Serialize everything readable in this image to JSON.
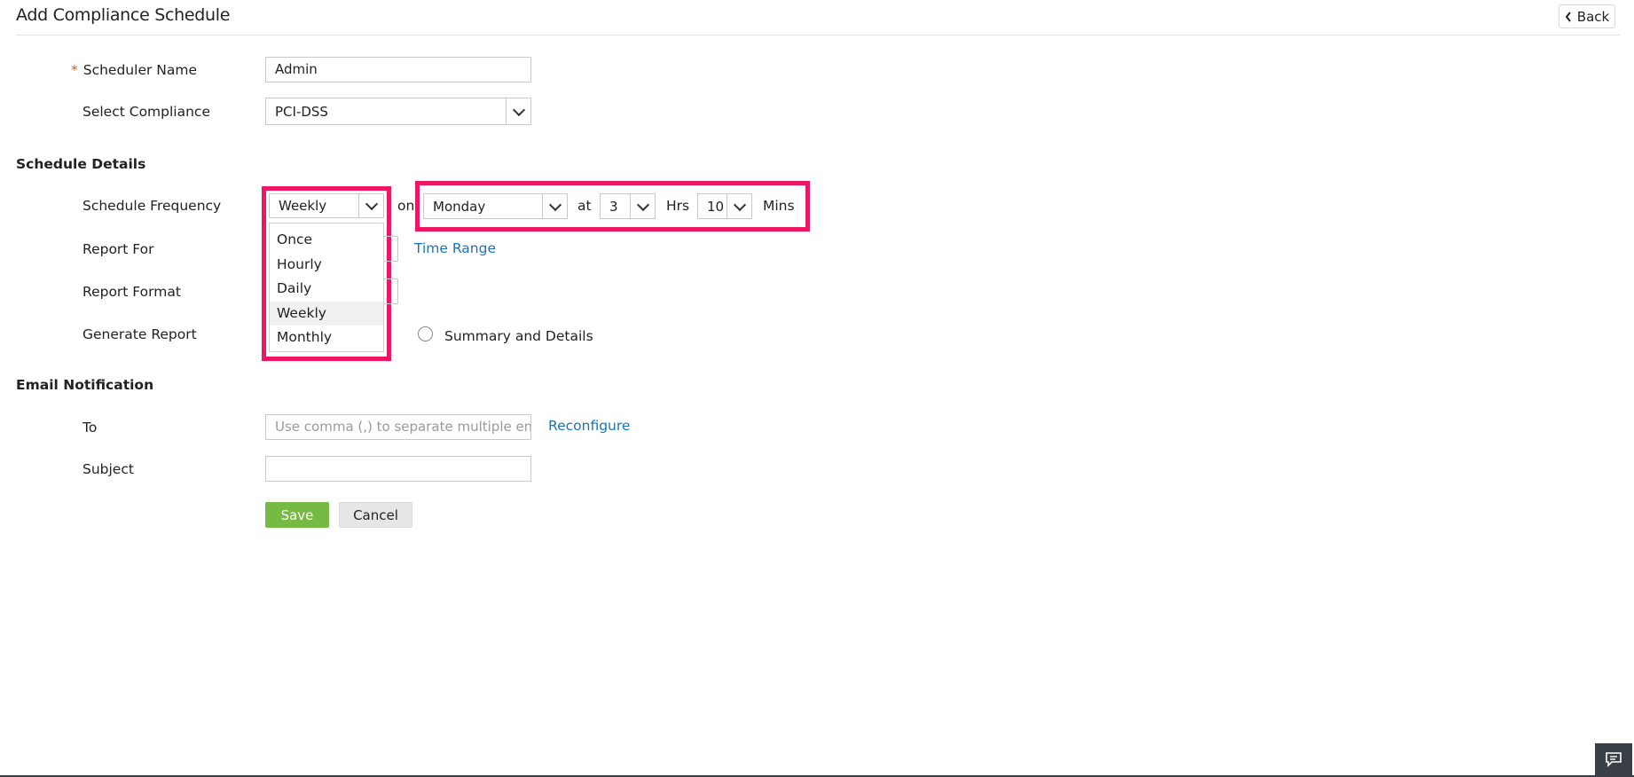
{
  "header": {
    "title": "Add Compliance Schedule",
    "back_label": "Back"
  },
  "form": {
    "scheduler_name": {
      "required_mark": "*",
      "label": "Scheduler Name",
      "value": "Admin"
    },
    "select_compliance": {
      "label": "Select Compliance",
      "value": "PCI-DSS"
    }
  },
  "schedule_details": {
    "heading": "Schedule Details",
    "frequency": {
      "label": "Schedule Frequency",
      "value": "Weekly",
      "options": [
        "Once",
        "Hourly",
        "Daily",
        "Weekly",
        "Monthly"
      ],
      "on_label": "on",
      "day_value": "Monday",
      "at_label": "at",
      "hour_value": "3",
      "hrs_label": "Hrs",
      "min_value": "10",
      "mins_label": "Mins"
    },
    "report_for": {
      "label": "Report For",
      "time_range_link": "Time Range"
    },
    "report_format": {
      "label": "Report Format"
    },
    "generate_report": {
      "label": "Generate Report",
      "option_summary_details": "Summary and Details"
    }
  },
  "email_notification": {
    "heading": "Email Notification",
    "to": {
      "label": "To",
      "placeholder": "Use comma (,) to separate multiple ema",
      "reconfigure_link": "Reconfigure"
    },
    "subject": {
      "label": "Subject",
      "value": ""
    }
  },
  "actions": {
    "save_label": "Save",
    "cancel_label": "Cancel"
  },
  "colors": {
    "highlight": "#ee1764",
    "save": "#76b943",
    "link": "#1a73b8",
    "required": "#e35c1f"
  },
  "icons": {
    "back": "chevron-left-icon",
    "dropdown": "chevron-down-icon",
    "feedback": "chat-icon"
  }
}
